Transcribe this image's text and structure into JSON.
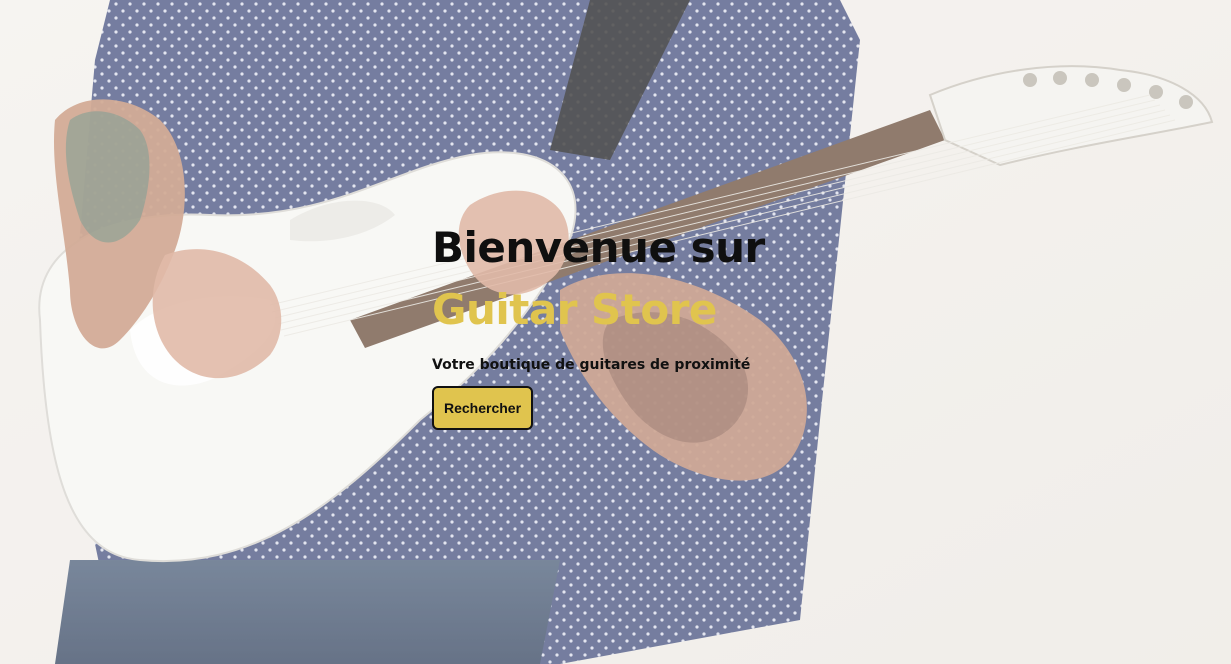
{
  "hero": {
    "title_prefix": "Bienvenue sur",
    "brand_name": "Guitar Store",
    "subtitle": "Votre boutique de guitares de proximité",
    "cta_label": "Rechercher"
  },
  "colors": {
    "brand": "#e0c44e",
    "heading": "#0f0f0f",
    "background": "#f1eeea"
  },
  "images": {
    "hero_background": "guitarist-photo"
  }
}
